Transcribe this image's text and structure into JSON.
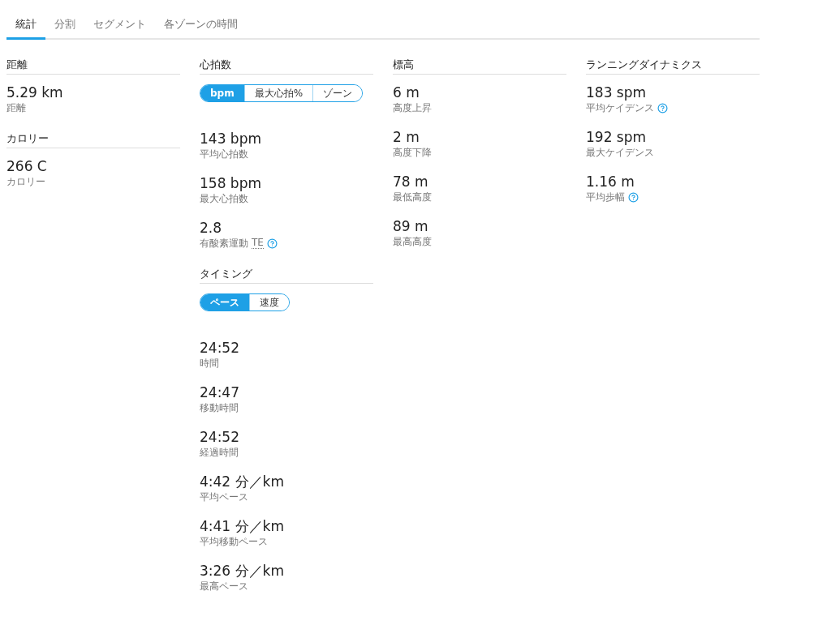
{
  "tabs": [
    {
      "label": "統計",
      "selected": true
    },
    {
      "label": "分割",
      "selected": false
    },
    {
      "label": "セグメント",
      "selected": false
    },
    {
      "label": "各ゾーンの時間",
      "selected": false
    }
  ],
  "columns": [
    {
      "sections": [
        {
          "title": "距離",
          "stats": [
            {
              "value": "5.29 km",
              "label": "距離"
            }
          ]
        },
        {
          "title": "カロリー",
          "stats": [
            {
              "value": "266 C",
              "label": "カロリー"
            }
          ]
        }
      ]
    },
    {
      "sections": [
        {
          "title": "心拍数",
          "toggle": [
            {
              "label": "bpm",
              "selected": true
            },
            {
              "label": "最大心拍%",
              "selected": false
            },
            {
              "label": "ゾーン",
              "selected": false
            }
          ],
          "stats": [
            {
              "value": "143 bpm",
              "label": "平均心拍数"
            },
            {
              "value": "158 bpm",
              "label": "最大心拍数"
            },
            {
              "value": "2.8",
              "label": "有酸素運動",
              "abbr": "TE",
              "help": true
            }
          ]
        },
        {
          "title": "タイミング",
          "toggle": [
            {
              "label": "ペース",
              "selected": true
            },
            {
              "label": "速度",
              "selected": false
            }
          ],
          "stats": [
            {
              "value": "24:52",
              "label": "時間"
            },
            {
              "value": "24:47",
              "label": "移動時間"
            },
            {
              "value": "24:52",
              "label": "経過時間"
            },
            {
              "value": "4:42 分／km",
              "label": "平均ペース"
            },
            {
              "value": "4:41 分／km",
              "label": "平均移動ペース"
            },
            {
              "value": "3:26 分／km",
              "label": "最高ペース"
            }
          ]
        }
      ]
    },
    {
      "sections": [
        {
          "title": "標高",
          "stats": [
            {
              "value": "6 m",
              "label": "高度上昇"
            },
            {
              "value": "2 m",
              "label": "高度下降"
            },
            {
              "value": "78 m",
              "label": "最低高度"
            },
            {
              "value": "89 m",
              "label": "最高高度"
            }
          ]
        }
      ]
    },
    {
      "sections": [
        {
          "title": "ランニングダイナミクス",
          "stats": [
            {
              "value": "183 spm",
              "label": "平均ケイデンス",
              "help": true
            },
            {
              "value": "192 spm",
              "label": "最大ケイデンス"
            },
            {
              "value": "1.16 m",
              "label": "平均歩幅",
              "help": true
            }
          ]
        }
      ]
    }
  ]
}
